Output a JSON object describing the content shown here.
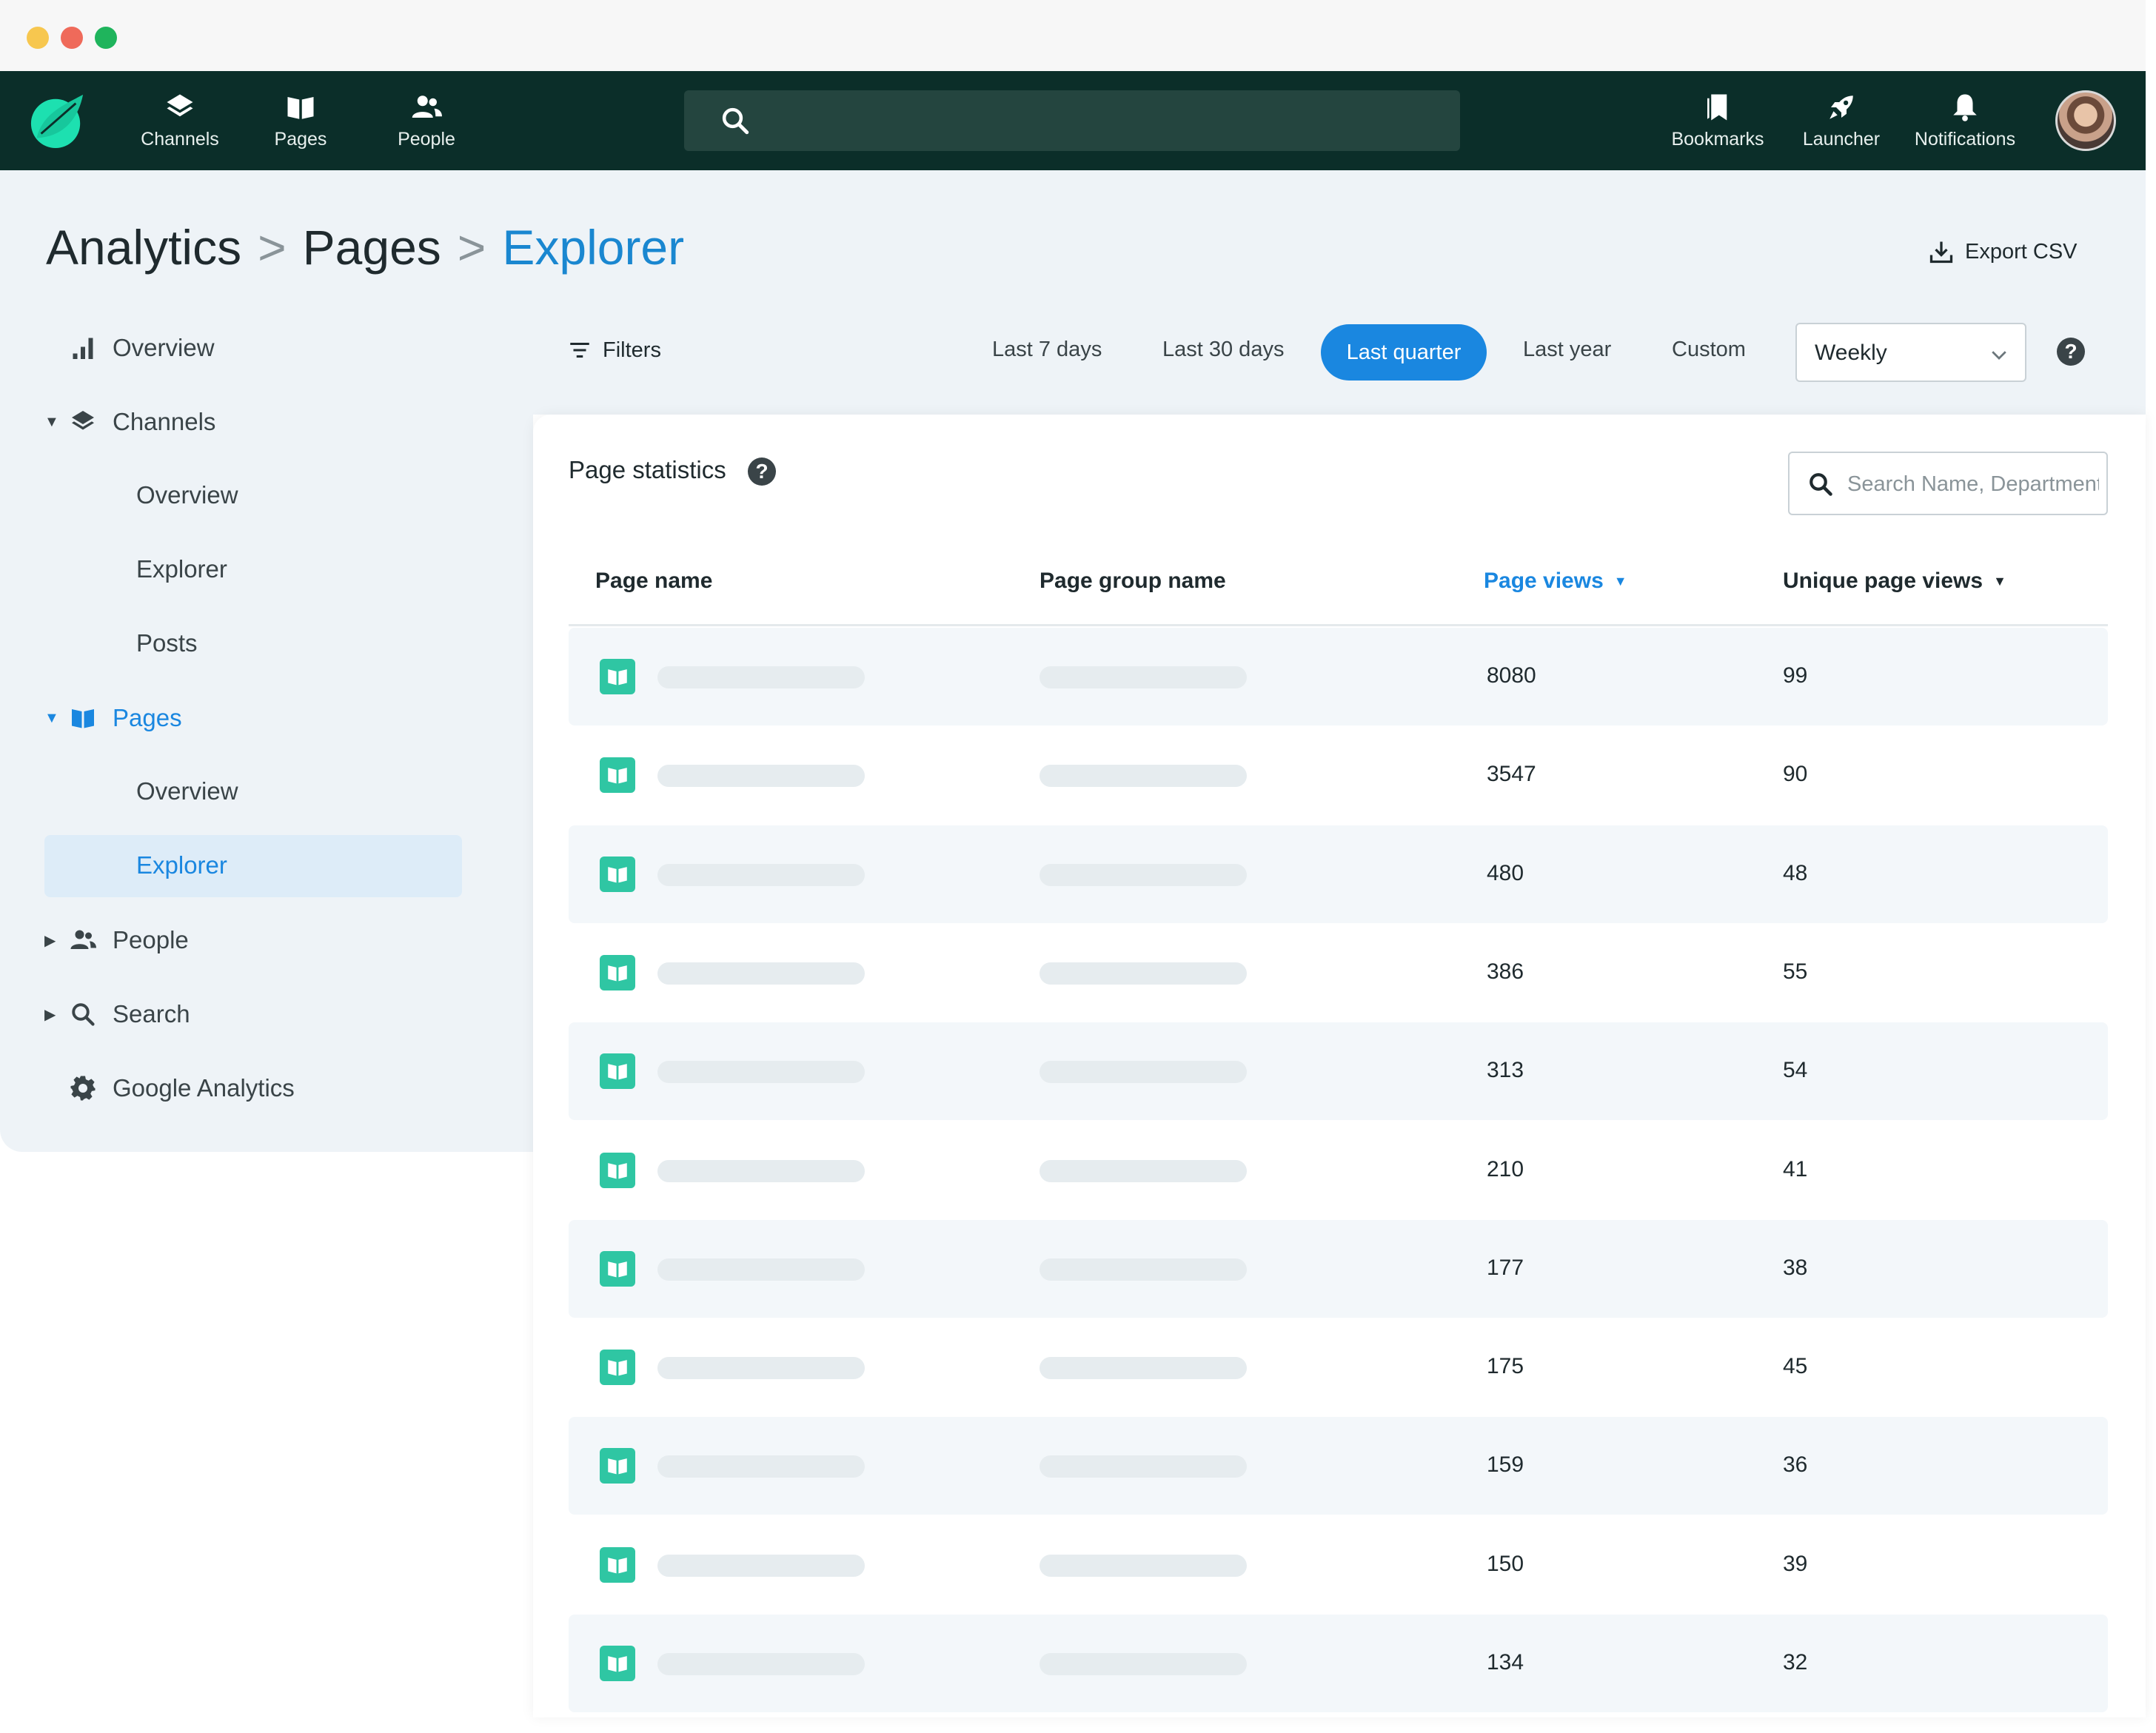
{
  "window": {
    "controls": [
      {
        "name": "minimize",
        "color": "#f7c74f"
      },
      {
        "name": "close",
        "color": "#ef6a5a"
      },
      {
        "name": "maximize",
        "color": "#1fb45c"
      }
    ]
  },
  "topnav": {
    "items": [
      {
        "label": "Channels",
        "icon": "layers-icon"
      },
      {
        "label": "Pages",
        "icon": "book-icon"
      },
      {
        "label": "People",
        "icon": "people-icon"
      }
    ],
    "right_items": [
      {
        "label": "Bookmarks",
        "icon": "bookmark-icon"
      },
      {
        "label": "Launcher",
        "icon": "rocket-icon"
      },
      {
        "label": "Notifications",
        "icon": "bell-icon"
      }
    ],
    "search_placeholder": ""
  },
  "breadcrumb": {
    "items": [
      "Analytics",
      "Pages",
      "Explorer"
    ],
    "separator": ">"
  },
  "export_label": "Export CSV",
  "sidebar": {
    "overview": "Overview",
    "channels": {
      "label": "Channels",
      "children": [
        "Overview",
        "Explorer",
        "Posts"
      ]
    },
    "pages": {
      "label": "Pages",
      "children": [
        "Overview",
        "Explorer"
      ],
      "active_child": "Explorer"
    },
    "people": "People",
    "search": "Search",
    "google_analytics": "Google Analytics"
  },
  "toolbar": {
    "filters_label": "Filters",
    "ranges": [
      "Last 7 days",
      "Last 30 days",
      "Last quarter",
      "Last year",
      "Custom"
    ],
    "active_range": "Last quarter",
    "interval": "Weekly",
    "help": "?"
  },
  "card": {
    "title": "Page statistics",
    "help": "?",
    "search_placeholder": "Search Name, Department"
  },
  "table": {
    "columns": [
      "Page name",
      "Page group name",
      "Page views",
      "Unique page views"
    ],
    "sorted_column": "Page views",
    "rows": [
      {
        "page_views": "8080",
        "unique": "99"
      },
      {
        "page_views": "3547",
        "unique": "90"
      },
      {
        "page_views": "480",
        "unique": "48"
      },
      {
        "page_views": "386",
        "unique": "55"
      },
      {
        "page_views": "313",
        "unique": "54"
      },
      {
        "page_views": "210",
        "unique": "41"
      },
      {
        "page_views": "177",
        "unique": "38"
      },
      {
        "page_views": "175",
        "unique": "45"
      },
      {
        "page_views": "159",
        "unique": "36"
      },
      {
        "page_views": "150",
        "unique": "39"
      },
      {
        "page_views": "134",
        "unique": "32"
      }
    ]
  },
  "colors": {
    "nav_bg": "#0b2e29",
    "accent": "#1a87e0",
    "page_icon": "#2fc6a3",
    "panel_bg": "#eef3f7"
  }
}
